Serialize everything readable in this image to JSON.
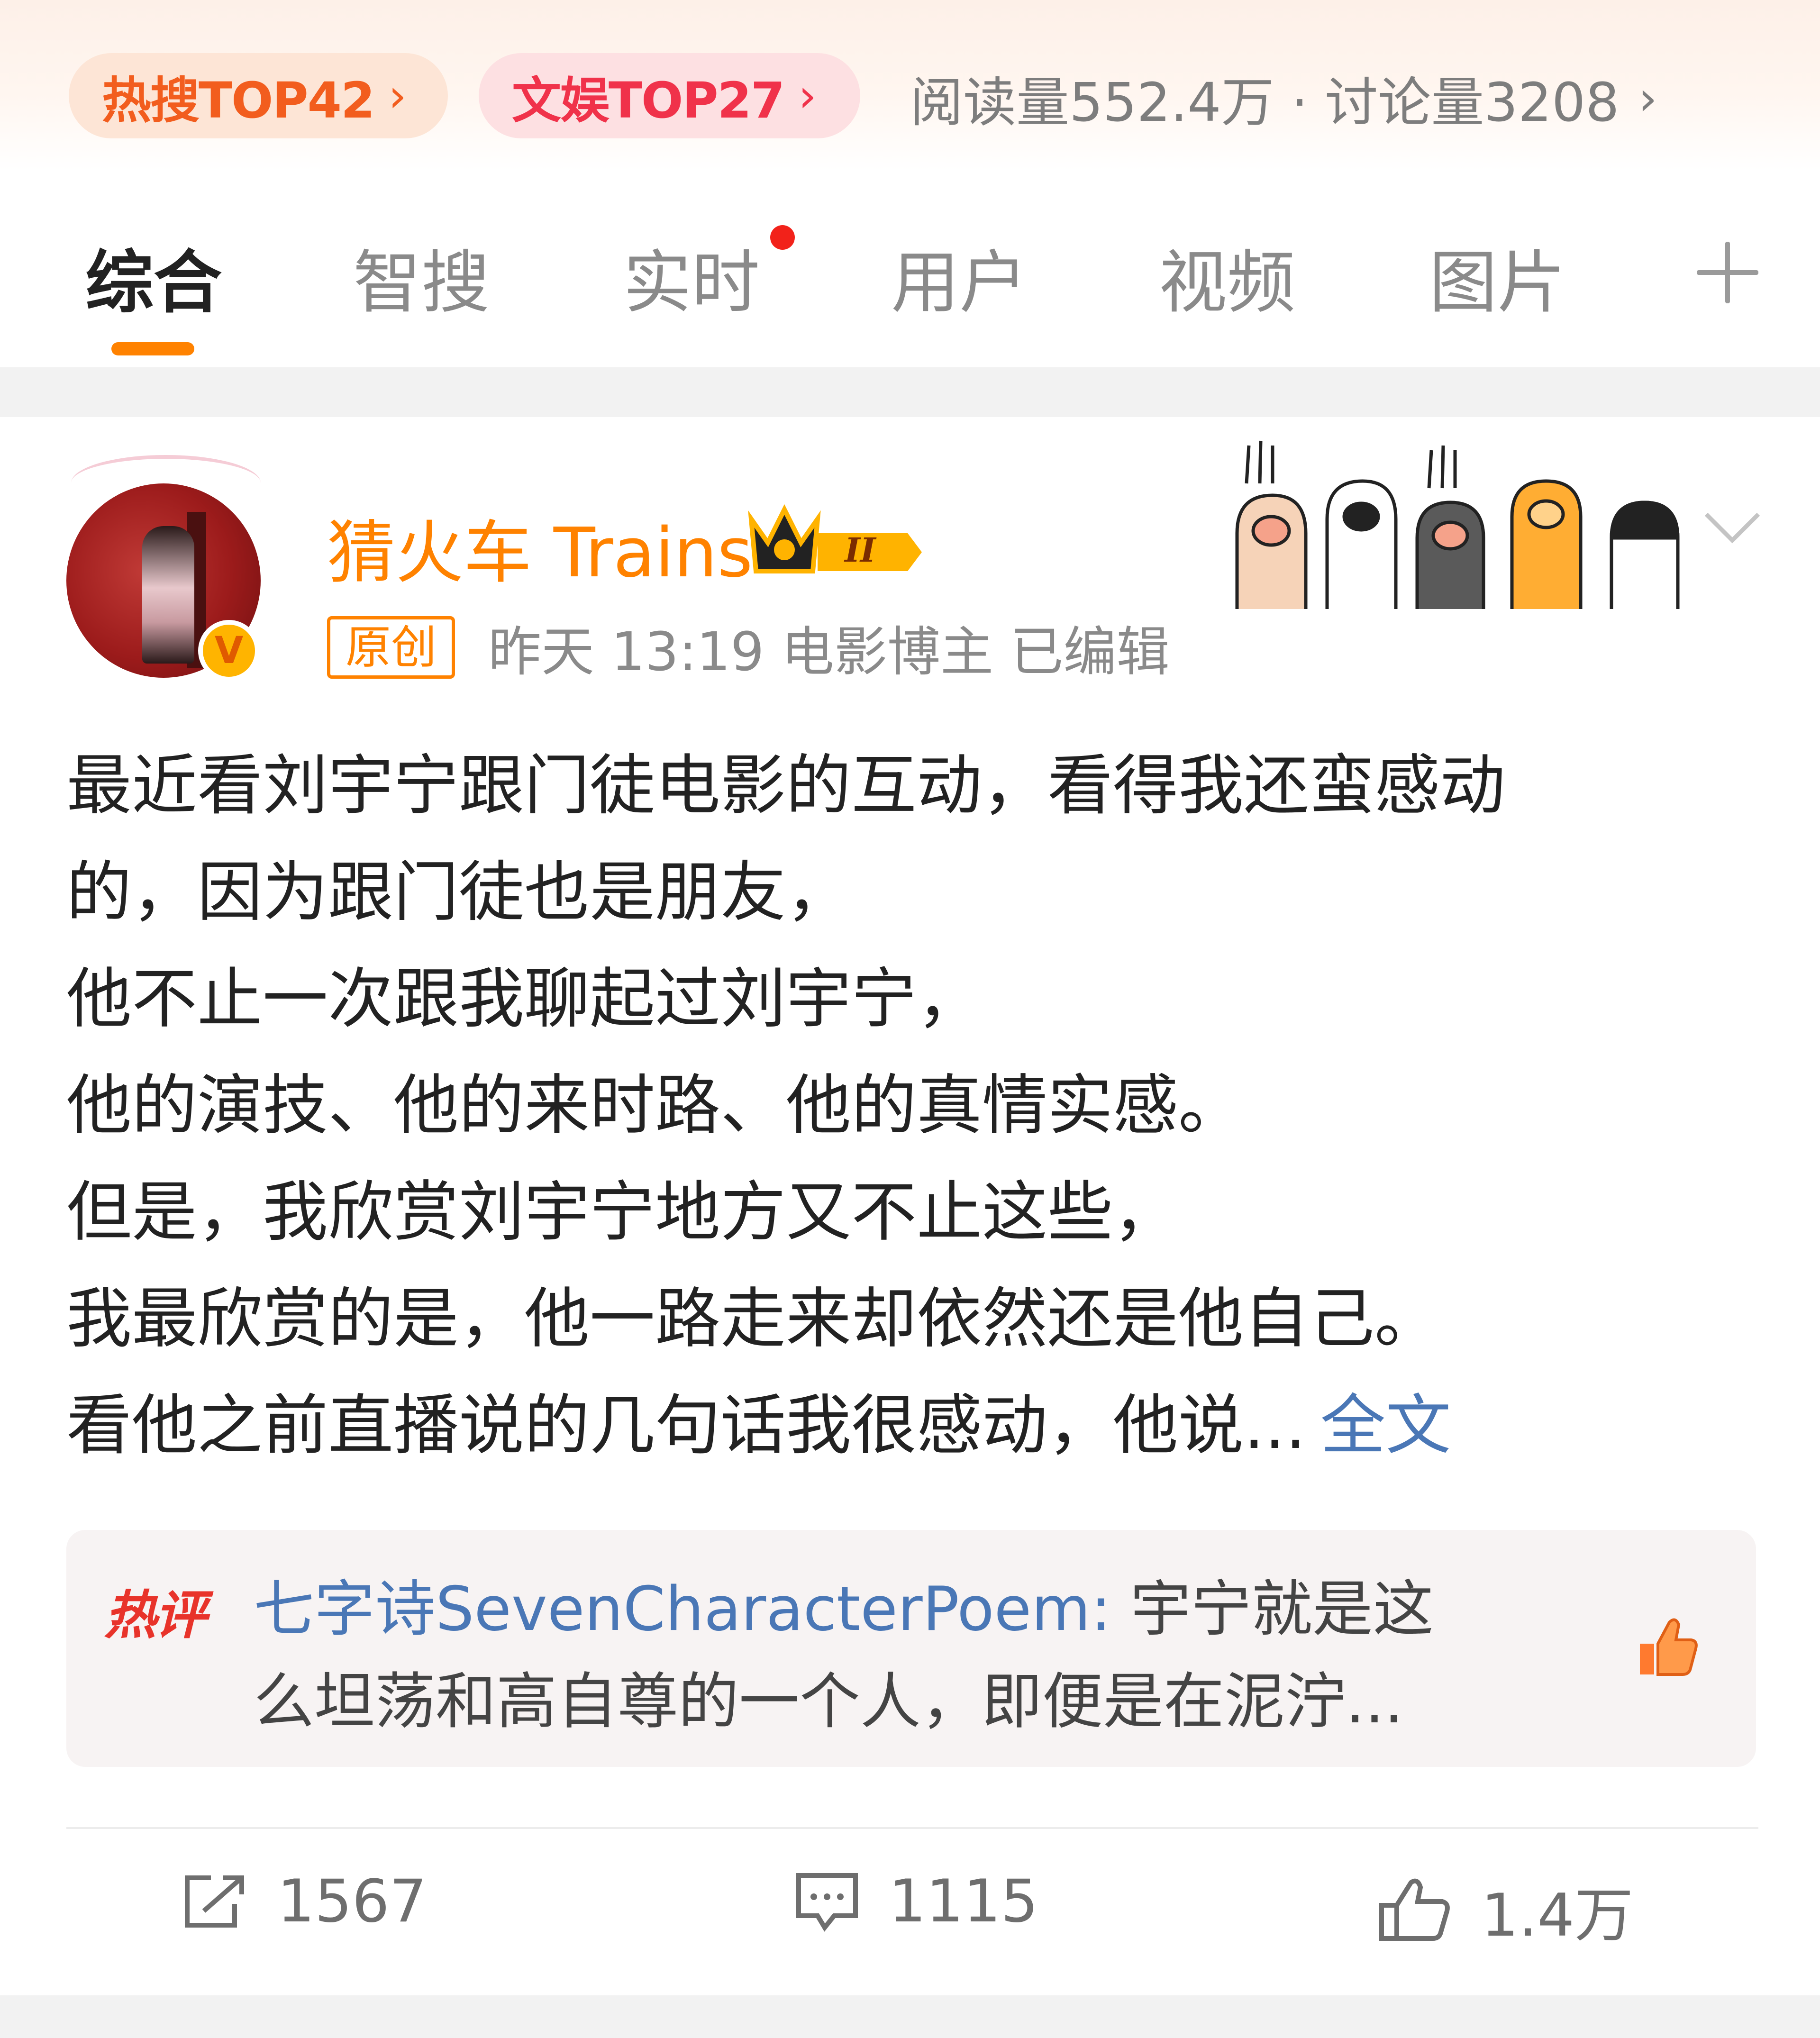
{
  "hot_bar": {
    "hot_search": "热搜TOP42",
    "entertainment": "文娱TOP27",
    "stats": "阅读量552.4万 · 讨论量3208",
    "chevron": "›"
  },
  "tabs": {
    "items": [
      {
        "label": "综合",
        "active": true
      },
      {
        "label": "智搜"
      },
      {
        "label": "实时",
        "has_dot": true
      },
      {
        "label": "用户"
      },
      {
        "label": "视频"
      },
      {
        "label": "图片"
      }
    ],
    "more_icon": "plus-icon",
    "accent": "#ff8200"
  },
  "post": {
    "username": "猜火车 Trains",
    "badge_level": "II",
    "verified_glyph": "V",
    "original_tag": "原创",
    "meta": "昨天 13:19  电影博主  已编辑",
    "body_lines": [
      "最近看刘宇宁跟门徒电影的互动，看得我还蛮感动",
      "的，因为跟门徒也是朋友，",
      "他不止一次跟我聊起过刘宇宁，",
      "他的演技、他的来时路、他的真情实感。",
      "但是，我欣赏刘宇宁地方又不止这些，",
      "我最欣赏的是，他一路走来却依然还是他自己。",
      "看他之前直播说的几句话我很感动，他说..."
    ],
    "full_text_link": "全文",
    "link_color": "#4a77b6"
  },
  "hot_comment": {
    "tag": "热评",
    "author": "七字诗SevenCharacterPoem:",
    "text_line1": " 宇宁就是这",
    "text_line2": "么坦荡和高自尊的一个人，即便是在泥泞..."
  },
  "actions": {
    "reposts": "1567",
    "comments": "1115",
    "likes": "1.4万"
  }
}
